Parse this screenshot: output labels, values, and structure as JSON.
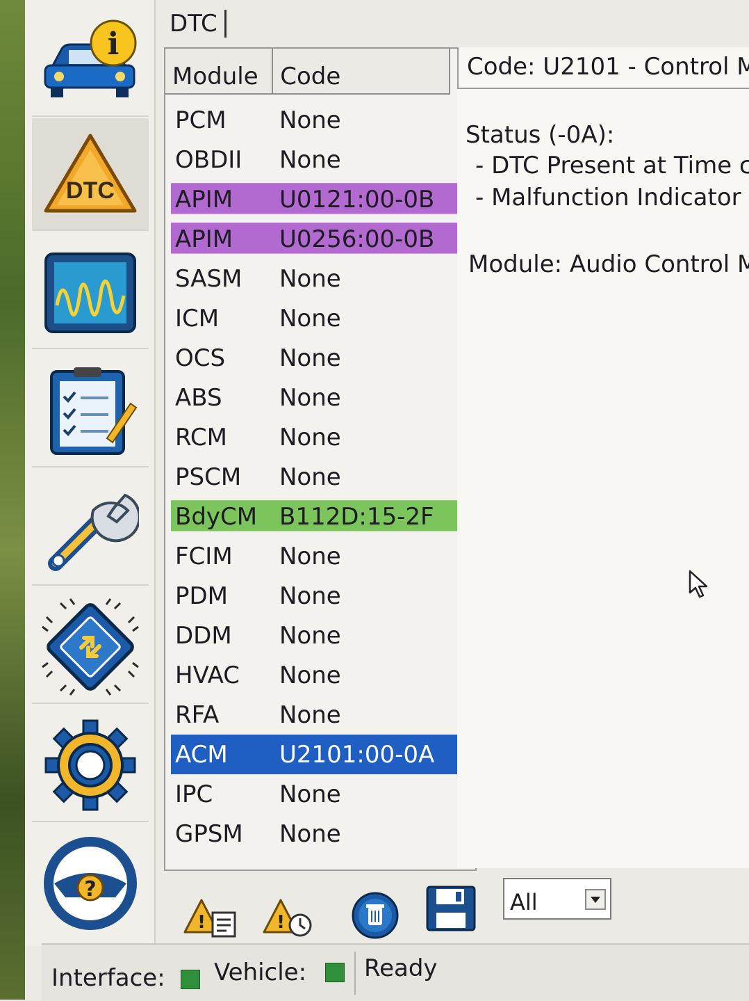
{
  "title": "DTC",
  "list": {
    "headers": {
      "module": "Module",
      "code": "Code"
    },
    "rows": [
      {
        "module": "PCM",
        "code": "None"
      },
      {
        "module": "OBDII",
        "code": "None"
      },
      {
        "module": "APIM",
        "code": "U0121:00-0B",
        "highlight": "#b26ad1"
      },
      {
        "module": "APIM",
        "code": "U0256:00-0B",
        "highlight": "#b26ad1"
      },
      {
        "module": "SASM",
        "code": "None"
      },
      {
        "module": "ICM",
        "code": "None"
      },
      {
        "module": "OCS",
        "code": "None"
      },
      {
        "module": "ABS",
        "code": "None"
      },
      {
        "module": "RCM",
        "code": "None"
      },
      {
        "module": "PSCM",
        "code": "None"
      },
      {
        "module": "BdyCM",
        "code": "B112D:15-2F",
        "highlight": "#7cc55c"
      },
      {
        "module": "FCIM",
        "code": "None"
      },
      {
        "module": "PDM",
        "code": "None"
      },
      {
        "module": "DDM",
        "code": "None"
      },
      {
        "module": "HVAC",
        "code": "None"
      },
      {
        "module": "RFA",
        "code": "None"
      },
      {
        "module": "ACM",
        "code": "U2101:00-0A",
        "selected": true
      },
      {
        "module": "IPC",
        "code": "None"
      },
      {
        "module": "GPSM",
        "code": "None"
      }
    ]
  },
  "detail": {
    "code_line": "Code: U2101 - Control M",
    "status_heading": "Status (-0A):",
    "status_items": [
      "- DTC Present at Time c",
      "- Malfunction Indicator I"
    ],
    "module_line": "Module: Audio Control M"
  },
  "sidebar": {
    "items": [
      {
        "icon": "vehicle-info-icon"
      },
      {
        "icon": "dtc-warning-icon",
        "label": "DTC"
      },
      {
        "icon": "oscilloscope-icon"
      },
      {
        "icon": "checklist-icon"
      },
      {
        "icon": "wrench-icon"
      },
      {
        "icon": "module-chip-icon"
      },
      {
        "icon": "settings-gear-icon"
      },
      {
        "icon": "help-steering-wheel-icon"
      }
    ]
  },
  "toolbar": {
    "icons": [
      "dtc-report-icon",
      "dtc-clear-icon",
      "delete-icon",
      "save-icon"
    ],
    "filter_value": "All"
  },
  "status": {
    "interface_label": "Interface:",
    "vehicle_label": "Vehicle:",
    "state": "Ready",
    "led_color": "#2f8f3a"
  },
  "colors": {
    "purple_highlight": "#b26ad1",
    "green_highlight": "#7cc55c",
    "selection": "#1f5fc4"
  }
}
